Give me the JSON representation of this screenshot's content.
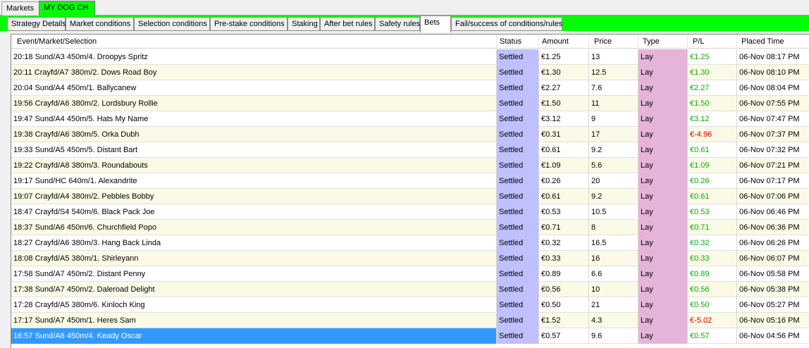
{
  "top_tabs": [
    {
      "label": "Markets",
      "active": false
    },
    {
      "label": "MY DOG CH",
      "active": true
    }
  ],
  "rule_tabs": [
    {
      "label": "Strategy Details",
      "active": false
    },
    {
      "label": "Market conditions",
      "active": false
    },
    {
      "label": "Selection conditions",
      "active": false
    },
    {
      "label": "Pre-stake conditions",
      "active": false
    },
    {
      "label": "Staking",
      "active": false
    },
    {
      "label": "After bet rules",
      "active": false
    },
    {
      "label": "Safety rules",
      "active": false
    },
    {
      "label": "Bets",
      "active": true
    },
    {
      "label": "Fail/success of conditions/rules",
      "active": false
    }
  ],
  "columns": [
    "Event/Market/Selection",
    "Status",
    "Amount",
    "Price",
    "Type",
    "P/L",
    "Placed Time"
  ],
  "rows": [
    {
      "event": "20:18 Sund/A3 450m/4. Droopys Spritz",
      "status": "Settled",
      "amount": "€1.25",
      "price": "13",
      "type": "Lay",
      "pl": "€1.25",
      "pl_sign": "pos",
      "time": "06-Nov 08:17 PM"
    },
    {
      "event": "20:11 Crayfd/A7 380m/2. Dows Road Boy",
      "status": "Settled",
      "amount": "€1.30",
      "price": "12.5",
      "type": "Lay",
      "pl": "€1.30",
      "pl_sign": "pos",
      "time": "06-Nov 08:10 PM"
    },
    {
      "event": "20:04 Sund/A4 450m/1. Ballycanew",
      "status": "Settled",
      "amount": "€2.27",
      "price": "7.6",
      "type": "Lay",
      "pl": "€2.27",
      "pl_sign": "pos",
      "time": "06-Nov 08:04 PM"
    },
    {
      "event": "19:56 Crayfd/A6 380m/2. Lordsbury Rollie",
      "status": "Settled",
      "amount": "€1.50",
      "price": "11",
      "type": "Lay",
      "pl": "€1.50",
      "pl_sign": "pos",
      "time": "06-Nov 07:55 PM"
    },
    {
      "event": "19:47 Sund/A4 450m/5. Hats My Name",
      "status": "Settled",
      "amount": "€3.12",
      "price": "9",
      "type": "Lay",
      "pl": "€3.12",
      "pl_sign": "pos",
      "time": "06-Nov 07:47 PM"
    },
    {
      "event": "19:38 Crayfd/A6 380m/5. Orka Dubh",
      "status": "Settled",
      "amount": "€0.31",
      "price": "17",
      "type": "Lay",
      "pl": "€-4.96",
      "pl_sign": "neg",
      "time": "06-Nov 07:37 PM"
    },
    {
      "event": "19:33 Sund/A5 450m/5. Distant Bart",
      "status": "Settled",
      "amount": "€0.61",
      "price": "9.2",
      "type": "Lay",
      "pl": "€0.61",
      "pl_sign": "pos",
      "time": "06-Nov 07:32 PM"
    },
    {
      "event": "19:22 Crayfd/A8 380m/3. Roundabouts",
      "status": "Settled",
      "amount": "€1.09",
      "price": "5.6",
      "type": "Lay",
      "pl": "€1.09",
      "pl_sign": "pos",
      "time": "06-Nov 07:21 PM"
    },
    {
      "event": "19:17 Sund/HC 640m/1. Alexandrite",
      "status": "Settled",
      "amount": "€0.26",
      "price": "20",
      "type": "Lay",
      "pl": "€0.26",
      "pl_sign": "pos",
      "time": "06-Nov 07:17 PM"
    },
    {
      "event": "19:07 Crayfd/A4 380m/2. Pebbles Bobby",
      "status": "Settled",
      "amount": "€0.61",
      "price": "9.2",
      "type": "Lay",
      "pl": "€0.61",
      "pl_sign": "pos",
      "time": "06-Nov 07:06 PM"
    },
    {
      "event": "18:47 Crayfd/S4 540m/6. Black Pack Joe",
      "status": "Settled",
      "amount": "€0.53",
      "price": "10.5",
      "type": "Lay",
      "pl": "€0.53",
      "pl_sign": "pos",
      "time": "06-Nov 06:46 PM"
    },
    {
      "event": "18:37 Sund/A6 450m/6. Churchfield Popo",
      "status": "Settled",
      "amount": "€0.71",
      "price": "8",
      "type": "Lay",
      "pl": "€0.71",
      "pl_sign": "pos",
      "time": "06-Nov 06:36 PM"
    },
    {
      "event": "18:27 Crayfd/A6 380m/3. Hang Back Linda",
      "status": "Settled",
      "amount": "€0.32",
      "price": "16.5",
      "type": "Lay",
      "pl": "€0.32",
      "pl_sign": "pos",
      "time": "06-Nov 06:26 PM"
    },
    {
      "event": "18:08 Crayfd/A5 380m/1. Shirleyann",
      "status": "Settled",
      "amount": "€0.33",
      "price": "16",
      "type": "Lay",
      "pl": "€0.33",
      "pl_sign": "pos",
      "time": "06-Nov 06:07 PM"
    },
    {
      "event": "17:58 Sund/A7 450m/2. Distant Penny",
      "status": "Settled",
      "amount": "€0.89",
      "price": "6.6",
      "type": "Lay",
      "pl": "€0.89",
      "pl_sign": "pos",
      "time": "06-Nov 05:58 PM"
    },
    {
      "event": "17:38 Sund/A7 450m/2. Daleroad Delight",
      "status": "Settled",
      "amount": "€0.56",
      "price": "10",
      "type": "Lay",
      "pl": "€0.56",
      "pl_sign": "pos",
      "time": "06-Nov 05:38 PM"
    },
    {
      "event": "17:28 Crayfd/A5 380m/6. Kinloch King",
      "status": "Settled",
      "amount": "€0.50",
      "price": "21",
      "type": "Lay",
      "pl": "€0.50",
      "pl_sign": "pos",
      "time": "06-Nov 05:27 PM"
    },
    {
      "event": "17:17 Sund/A7 450m/1. Heres Sam",
      "status": "Settled",
      "amount": "€1.52",
      "price": "4.3",
      "type": "Lay",
      "pl": "€-5.02",
      "pl_sign": "neg",
      "time": "06-Nov 05:16 PM"
    },
    {
      "event": "16:57 Sund/A8 450m/4. Keady Oscar",
      "status": "Settled",
      "amount": "€0.57",
      "price": "9.6",
      "type": "Lay",
      "pl": "€0.57",
      "pl_sign": "pos",
      "time": "06-Nov 04:56 PM",
      "selected": true
    }
  ]
}
